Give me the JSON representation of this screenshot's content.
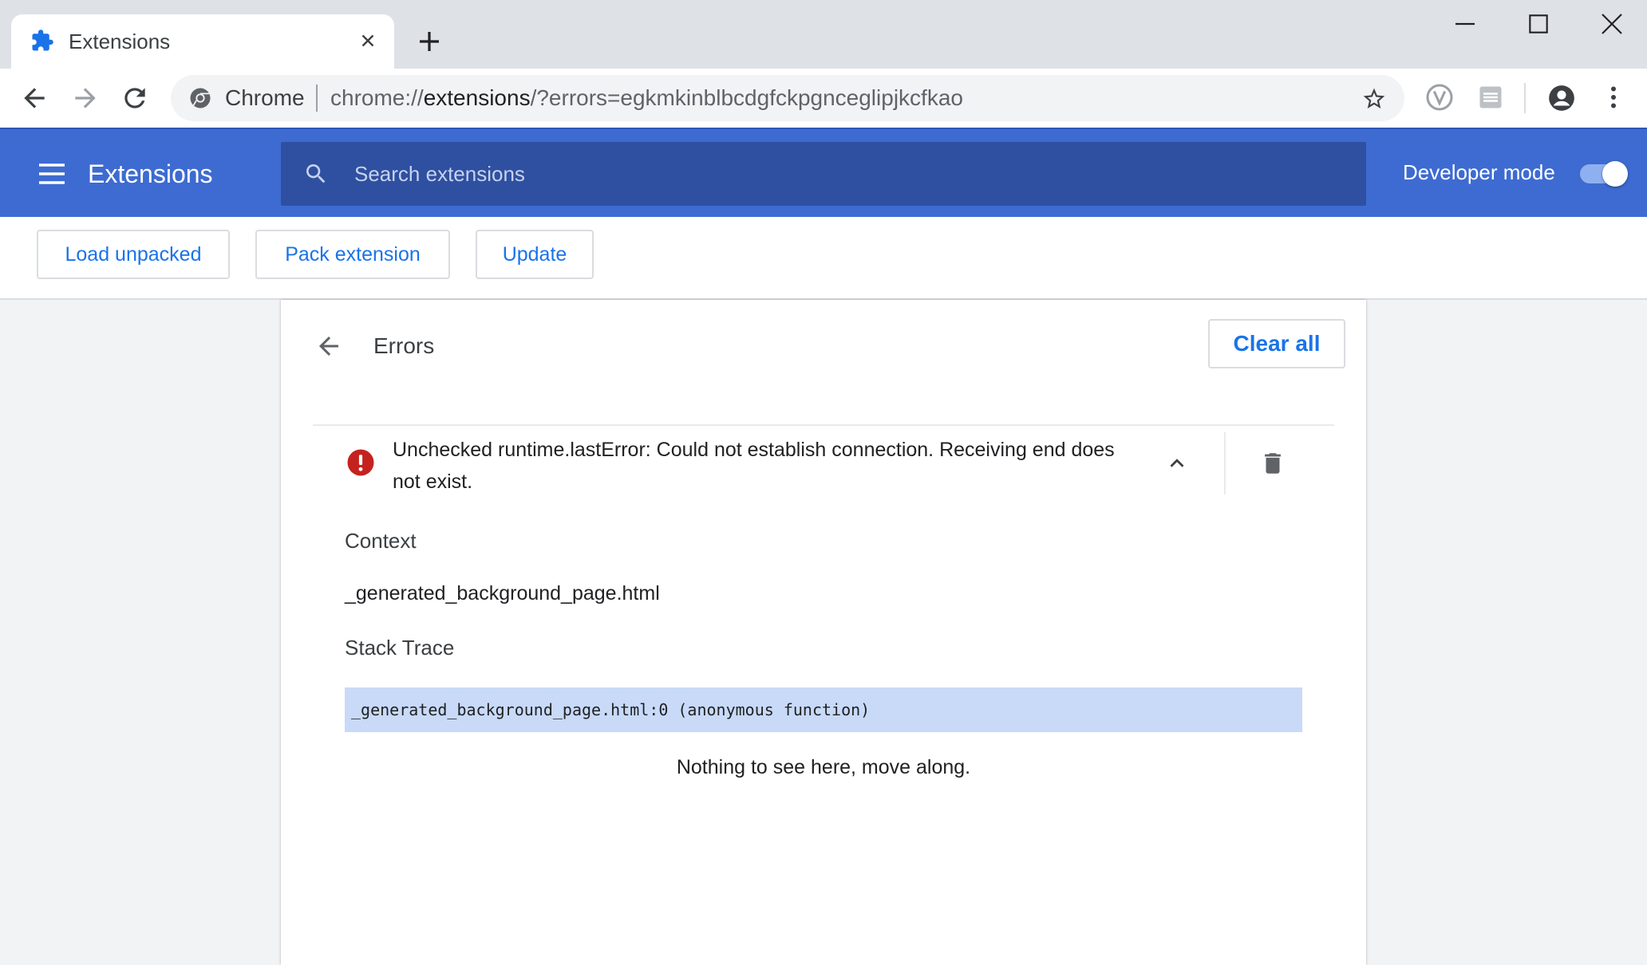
{
  "browser": {
    "tab": {
      "title": "Extensions",
      "icon": "puzzle-piece-icon"
    },
    "new_tab_icon": "plus-icon",
    "window_controls": [
      "minimize-icon",
      "maximize-icon",
      "close-icon"
    ],
    "omnibox": {
      "site_name": "Chrome",
      "url_prefix": "chrome://",
      "url_host": "extensions",
      "url_suffix": "/?errors=egkmkinblbcdgfckpgnceglipjkcfkao"
    }
  },
  "header": {
    "title": "Extensions",
    "search_placeholder": "Search extensions",
    "developer_mode_label": "Developer mode",
    "developer_mode_on": true
  },
  "actions": {
    "load_unpacked": "Load unpacked",
    "pack_extension": "Pack extension",
    "update": "Update"
  },
  "errors_page": {
    "title": "Errors",
    "clear_all": "Clear all",
    "error": {
      "message": "Unchecked runtime.lastError: Could not establish connection. Receiving end does not exist.",
      "context_heading": "Context",
      "context_value": "_generated_background_page.html",
      "stack_heading": "Stack Trace",
      "stack_line": "_generated_background_page.html:0 (anonymous function)",
      "empty_note": "Nothing to see here, move along."
    }
  },
  "colors": {
    "header_blue": "#3d6bd1",
    "search_blue": "#2f50a0",
    "link_blue": "#1a73e8",
    "error_red": "#c5221f",
    "stack_highlight": "#c8daf8"
  }
}
